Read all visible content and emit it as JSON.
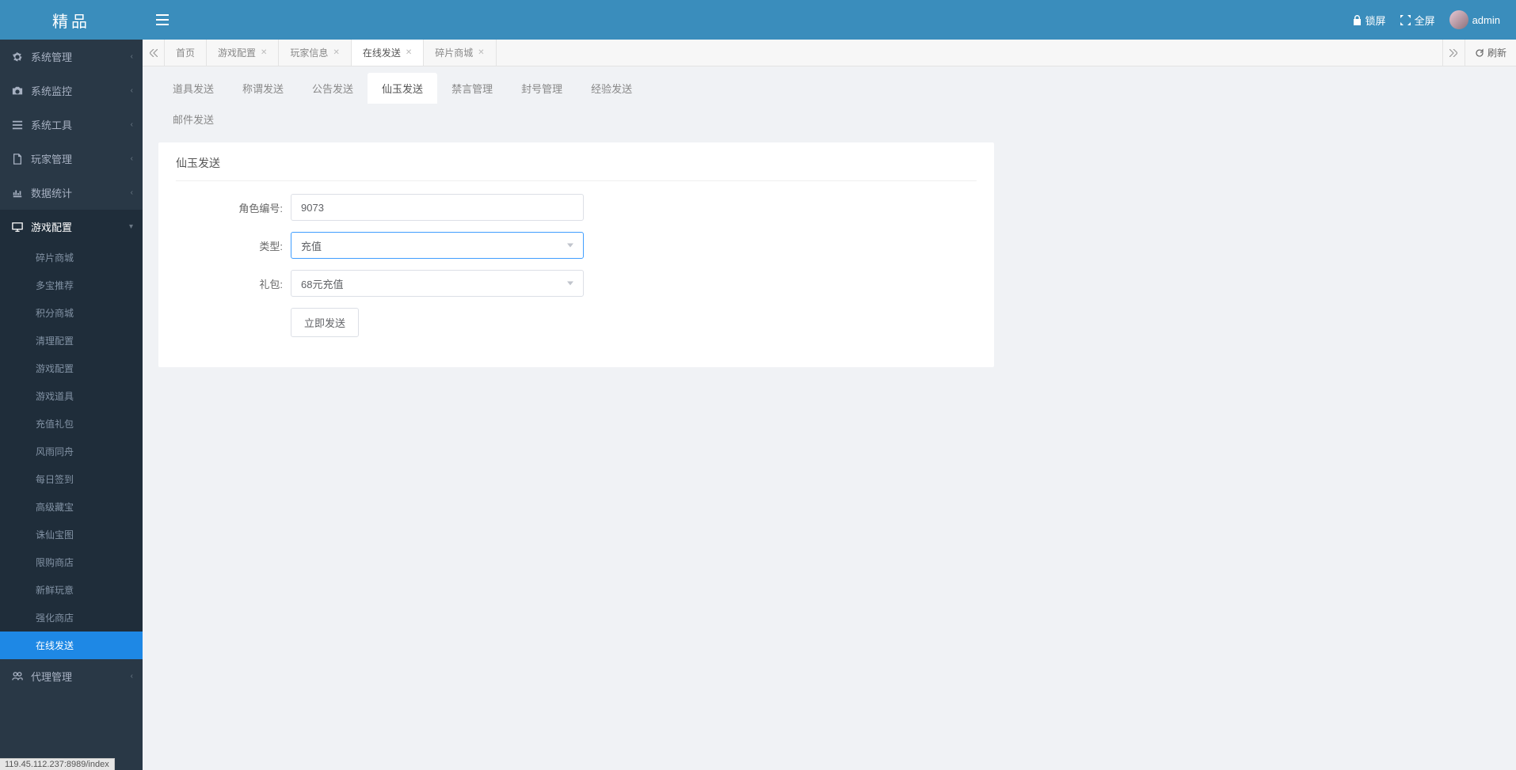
{
  "brand": "精品",
  "topbar": {
    "lock": "锁屏",
    "fullscreen": "全屏",
    "user": "admin"
  },
  "sidebar": {
    "items": [
      {
        "icon": "gear",
        "label": "系统管理"
      },
      {
        "icon": "camera",
        "label": "系统监控"
      },
      {
        "icon": "bars",
        "label": "系统工具"
      },
      {
        "icon": "file",
        "label": "玩家管理"
      },
      {
        "icon": "chart",
        "label": "数据统计"
      },
      {
        "icon": "monitor",
        "label": "游戏配置",
        "expanded": true
      },
      {
        "icon": "users",
        "label": "代理管理"
      }
    ],
    "gameConfigChildren": [
      "碎片商城",
      "多宝推荐",
      "积分商城",
      "清理配置",
      "游戏配置",
      "游戏道具",
      "充值礼包",
      "风雨同舟",
      "每日签到",
      "高级藏宝",
      "诛仙宝图",
      "限购商店",
      "新鲜玩意",
      "强化商店",
      "在线发送"
    ],
    "activeChild": "在线发送"
  },
  "tabs": {
    "items": [
      {
        "label": "首页",
        "closable": false
      },
      {
        "label": "游戏配置",
        "closable": true
      },
      {
        "label": "玩家信息",
        "closable": true
      },
      {
        "label": "在线发送",
        "closable": true,
        "active": true
      },
      {
        "label": "碎片商城",
        "closable": true
      }
    ],
    "refresh": "刷新"
  },
  "innerTabs": {
    "row1": [
      "道具发送",
      "称谓发送",
      "公告发送",
      "仙玉发送",
      "禁言管理",
      "封号管理",
      "经验发送"
    ],
    "row2": [
      "邮件发送"
    ],
    "active": "仙玉发送"
  },
  "form": {
    "title": "仙玉发送",
    "roleId": {
      "label": "角色编号:",
      "value": "9073"
    },
    "type": {
      "label": "类型:",
      "value": "充值"
    },
    "pack": {
      "label": "礼包:",
      "value": "68元充值"
    },
    "submit": "立即发送"
  },
  "statusBar": "119.45.112.237:8989/index"
}
